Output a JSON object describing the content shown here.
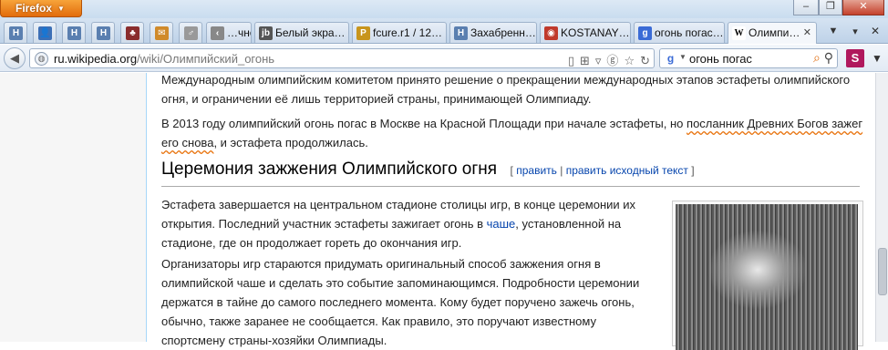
{
  "window": {
    "app_button_label": "Firefox",
    "minimize_label": "–",
    "restore_label": "❐",
    "close_label": "✕"
  },
  "app_tabs": [
    {
      "icon": "h-favicon",
      "color": "#5a7fb0",
      "glyph": "H"
    },
    {
      "icon": "person-favicon",
      "color": "#3b6fb6",
      "glyph": "👤"
    },
    {
      "icon": "h-favicon",
      "color": "#5a7fb0",
      "glyph": "H"
    },
    {
      "icon": "h-favicon",
      "color": "#5a7fb0",
      "glyph": "H"
    },
    {
      "icon": "avatar-favicon",
      "color": "#8a2d2d",
      "glyph": "♣"
    },
    {
      "icon": "mail-favicon",
      "color": "#d08a2a",
      "glyph": "✉"
    },
    {
      "icon": "gender-favicon",
      "color": "#999999",
      "glyph": "♂"
    }
  ],
  "tabs": [
    {
      "label": "…чно…",
      "icon": "page-favicon",
      "color": "#888888",
      "glyph": "‹"
    },
    {
      "label": "Белый экра…",
      "icon": "jb-favicon",
      "color": "#555555",
      "glyph": "jb"
    },
    {
      "label": "fcure.r1 / 12…",
      "icon": "fcure-favicon",
      "color": "#c8951c",
      "glyph": "P"
    },
    {
      "label": "Захабренн…",
      "icon": "h-favicon",
      "color": "#5a7fb0",
      "glyph": "H"
    },
    {
      "label": "KOSTANAY…",
      "icon": "kostanay-favicon",
      "color": "#c0392b",
      "glyph": "◉"
    },
    {
      "label": "огонь погас…",
      "icon": "google-favicon",
      "color": "#3a6bd6",
      "glyph": "g"
    },
    {
      "label": "Олимпи…",
      "icon": "wikipedia-favicon",
      "color": "#ffffff",
      "glyph": "W",
      "active": true
    }
  ],
  "nav": {
    "url_host": "ru.wikipedia.org",
    "url_path": "/wiki/Олимпийский_огонь",
    "search_text": "огонь погас",
    "search_engine": "g"
  },
  "article": {
    "p1": "Международным олимпийским комитетом принято решение о прекращении международных этапов эстафеты олимпийского огня, и ограничении её лишь территорией страны, принимающей Олимпиаду.",
    "p2_start": "В 2013 году олимпийский огонь погас в Москве на Красной Площади при начале эстафеты, но ",
    "p2_link": "посланник Древних Богов зажег его снова",
    "p2_end": ", и эстафета продолжилась.",
    "heading": "Церемония зажжения Олимпийского огня",
    "edit_open": "[",
    "edit_link": "править",
    "edit_sep": "|",
    "edit_source_link": "править исходный текст",
    "edit_close": "]",
    "p3_start": "Эстафета завершается на центральном стадионе столицы игр, в конце церемонии их открытия. Последний участник эстафеты зажигает огонь в ",
    "p3_link": "чаше",
    "p3_end": ", установленной на стадионе, где он продолжает гореть до окончания игр.",
    "p4": "Организаторы игр стараются придумать оригинальный способ зажжения огня в олимпийской чаше и сделать это событие запоминающимся. Подробности церемонии держатся в тайне до самого последнего момента. Кому будет поручено зажечь огонь, обычно, также заранее не сообщается. Как правило, это поручают известному спортсмену страны-хозяйки Олимпиады."
  }
}
